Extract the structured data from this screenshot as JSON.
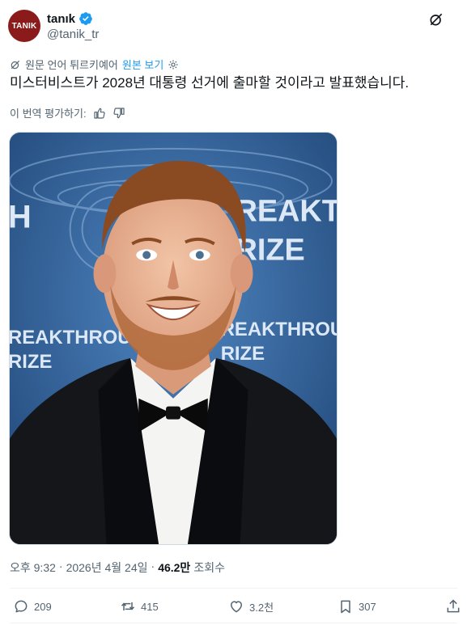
{
  "author": {
    "avatar_text": "TANIK",
    "display_name": "tanık",
    "handle": "@tanik_tr"
  },
  "translation": {
    "source_label": "원문 언어 튀르키예어",
    "show_original": "원본 보기"
  },
  "tweet": {
    "text": "미스터비스트가 2028년 대통령 선거에 출마할 것이라고 발표했습니다."
  },
  "rate": {
    "label": "이 번역 평가하기:"
  },
  "media": {
    "backdrop_text_left": "REAKTHROU",
    "backdrop_text_left2": "RIZE",
    "backdrop_text_right": "REAKTH",
    "backdrop_text_right2": "RIZE",
    "backdrop_text_right3": "REAKTHROUG",
    "backdrop_text_right4": "RIZE",
    "backdrop_letter": "H"
  },
  "meta": {
    "time": "오후 9:32",
    "separator": "·",
    "date": "2026년 4월 24일",
    "separator2": "·",
    "views_count": "46.2만",
    "views_label": "조회수"
  },
  "actions": {
    "replies": "209",
    "reposts": "415",
    "likes": "3.2천",
    "bookmarks": "307"
  },
  "colors": {
    "accent": "#1d9bf0",
    "avatar_bg": "#8b1a1a",
    "muted": "#536471"
  }
}
